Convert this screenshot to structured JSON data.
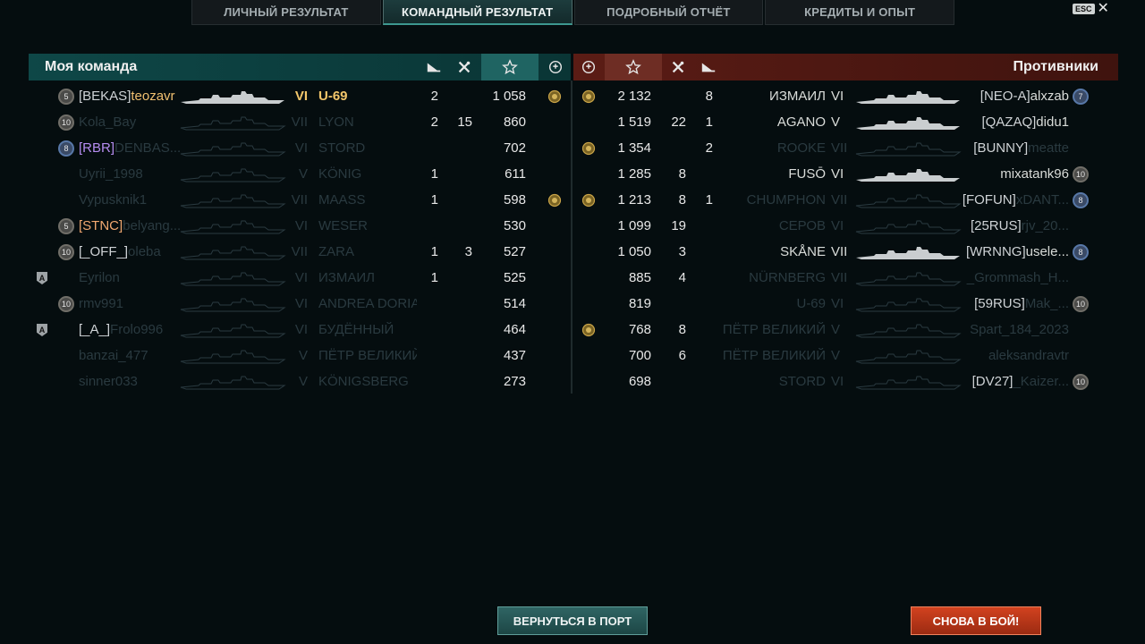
{
  "tabs": [
    {
      "label": "ЛИЧНЫЙ РЕЗУЛЬТАТ",
      "active": false
    },
    {
      "label": "КОМАНДНЫЙ РЕЗУЛЬТАТ",
      "active": true
    },
    {
      "label": "ПОДРОБНЫЙ ОТЧЁТ",
      "active": false
    },
    {
      "label": "КРЕДИТЫ И ОПЫТ",
      "active": false
    }
  ],
  "esc": {
    "key": "ESC",
    "close": "✕"
  },
  "ally": {
    "title": "Моя команда",
    "columns": [
      "plane-icon",
      "frag-icon",
      "star-icon",
      "medal-icon"
    ],
    "rows": [
      {
        "badge": "5",
        "clan": "[BEKAS]",
        "player": "teozavr",
        "tier": "VI",
        "ship": "U-69",
        "planes": "2",
        "frags": "",
        "xp": "1 058",
        "medal": true,
        "style": "me"
      },
      {
        "badge": "10",
        "clan": "",
        "player": "Kola_Bay",
        "tier": "VII",
        "ship": "LYON",
        "planes": "2",
        "frags": "15",
        "xp": "860",
        "medal": false,
        "style": "dead"
      },
      {
        "badge": "8",
        "clan": "[RBR]",
        "player": "DENBAS...",
        "tier": "VI",
        "ship": "STORD",
        "planes": "",
        "frags": "",
        "xp": "702",
        "medal": false,
        "style": "dead",
        "clan_color": "#b58cf0"
      },
      {
        "badge": "",
        "clan": "",
        "player": "Uyrii_1998",
        "tier": "V",
        "ship": "KÖNIG",
        "planes": "1",
        "frags": "",
        "xp": "611",
        "medal": false,
        "style": "dead"
      },
      {
        "badge": "",
        "clan": "",
        "player": "Vypusknik1",
        "tier": "VII",
        "ship": "MAASS",
        "planes": "1",
        "frags": "",
        "xp": "598",
        "medal": true,
        "style": "dead"
      },
      {
        "badge": "5",
        "clan": "[STNC]",
        "player": "belyang...",
        "tier": "VI",
        "ship": "WESER",
        "planes": "",
        "frags": "",
        "xp": "530",
        "medal": false,
        "style": "dead",
        "clan_color": "#f0a870"
      },
      {
        "badge": "10",
        "clan": "[_OFF_]",
        "player": "oleba",
        "tier": "VII",
        "ship": "ZARA",
        "planes": "1",
        "frags": "3",
        "xp": "527",
        "medal": false,
        "style": "dead"
      },
      {
        "badge": "A",
        "clan": "",
        "player": "Eyrilon",
        "tier": "VI",
        "ship": "ИЗМАИЛ",
        "planes": "1",
        "frags": "",
        "xp": "525",
        "medal": false,
        "style": "dead"
      },
      {
        "badge": "10",
        "clan": "",
        "player": "rmv991",
        "tier": "VI",
        "ship": "ANDREA DORIA",
        "planes": "",
        "frags": "",
        "xp": "514",
        "medal": false,
        "style": "dead"
      },
      {
        "badge": "A",
        "clan": "[_A_]",
        "player": "Frolo996",
        "tier": "VI",
        "ship": "БУДЁННЫЙ",
        "planes": "",
        "frags": "",
        "xp": "464",
        "medal": false,
        "style": "dead"
      },
      {
        "badge": "",
        "clan": "",
        "player": "banzai_477",
        "tier": "V",
        "ship": "ПЁТР ВЕЛИКИЙ",
        "planes": "",
        "frags": "",
        "xp": "437",
        "medal": false,
        "style": "dead"
      },
      {
        "badge": "",
        "clan": "",
        "player": "sinner033",
        "tier": "V",
        "ship": "KÖNIGSBERG",
        "planes": "",
        "frags": "",
        "xp": "273",
        "medal": false,
        "style": "dead"
      }
    ]
  },
  "enemy": {
    "title": "Противники",
    "columns": [
      "medal-icon",
      "star-icon",
      "frag-icon",
      "plane-icon"
    ],
    "rows": [
      {
        "medal": true,
        "xp": "2 132",
        "frags": "",
        "planes": "8",
        "ship": "ИЗМАИЛ",
        "tier": "VI",
        "clan": "[NEO-A]",
        "player": "alxzab",
        "badge": "7",
        "style": "live"
      },
      {
        "medal": false,
        "xp": "1 519",
        "frags": "22",
        "planes": "1",
        "ship": "AGANO",
        "tier": "V",
        "clan": "[QAZAQ]",
        "player": "didu1",
        "badge": "",
        "style": "live"
      },
      {
        "medal": true,
        "xp": "1 354",
        "frags": "",
        "planes": "2",
        "ship": "ROOKE",
        "tier": "VII",
        "clan": "[BUNNY]",
        "player": "meatte",
        "badge": "",
        "style": "dead"
      },
      {
        "medal": false,
        "xp": "1 285",
        "frags": "8",
        "planes": "",
        "ship": "FUSŌ",
        "tier": "VI",
        "clan": "",
        "player": "mixatank96",
        "badge": "10",
        "style": "live"
      },
      {
        "medal": true,
        "xp": "1 213",
        "frags": "8",
        "planes": "1",
        "ship": "CHUMPHON",
        "tier": "VII",
        "clan": "[FOFUN]",
        "player": "xDANT...",
        "badge": "8",
        "style": "dead"
      },
      {
        "medal": false,
        "xp": "1 099",
        "frags": "19",
        "planes": "",
        "ship": "СЕРОВ",
        "tier": "VI",
        "clan": "[25RUS]",
        "player": "rjv_20...",
        "badge": "",
        "style": "dead"
      },
      {
        "medal": false,
        "xp": "1 050",
        "frags": "3",
        "planes": "",
        "ship": "SKÅNE",
        "tier": "VII",
        "clan": "[WRNNG]",
        "player": "usele...",
        "badge": "8",
        "style": "live"
      },
      {
        "medal": false,
        "xp": "885",
        "frags": "4",
        "planes": "",
        "ship": "NÜRNBERG",
        "tier": "VII",
        "clan": "",
        "player": "_Grommash_H...",
        "badge": "",
        "style": "dead"
      },
      {
        "medal": false,
        "xp": "819",
        "frags": "",
        "planes": "",
        "ship": "U-69",
        "tier": "VI",
        "clan": "[59RUS]",
        "player": "Mak_...",
        "badge": "10",
        "style": "dead"
      },
      {
        "medal": true,
        "xp": "768",
        "frags": "8",
        "planes": "",
        "ship": "ПЁТР ВЕЛИКИЙ",
        "tier": "V",
        "clan": "",
        "player": "Spart_184_2023",
        "badge": "",
        "style": "dead"
      },
      {
        "medal": false,
        "xp": "700",
        "frags": "6",
        "planes": "",
        "ship": "ПЁТР ВЕЛИКИЙ",
        "tier": "V",
        "clan": "",
        "player": "aleksandravtr",
        "badge": "",
        "style": "dead"
      },
      {
        "medal": false,
        "xp": "698",
        "frags": "",
        "planes": "",
        "ship": "STORD",
        "tier": "VI",
        "clan": "[DV27]",
        "player": "_Kaizer...",
        "badge": "10",
        "style": "dead"
      }
    ]
  },
  "buttons": {
    "port": "ВЕРНУТЬСЯ В ПОРТ",
    "again": "СНОВА В БОЙ!"
  },
  "colors": {
    "ally_header": "#0e4747",
    "enemy_header": "#5b1c15",
    "accent_me": "#f3c66a",
    "button_port": "#2f6564",
    "button_again": "#d2421f"
  }
}
